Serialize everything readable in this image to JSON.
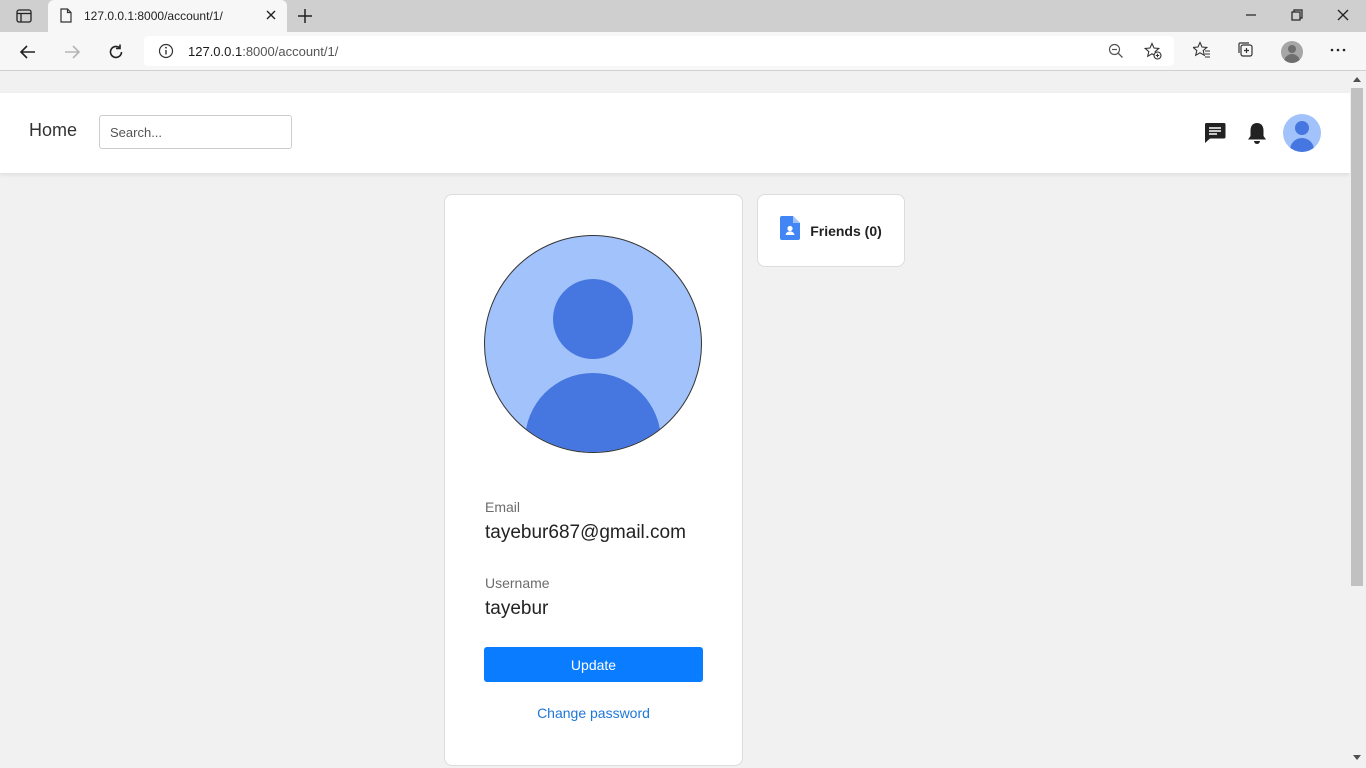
{
  "browser": {
    "tab_title": "127.0.0.1:8000/account/1/",
    "url_host": "127.0.0.1",
    "url_path": ":8000/account/1/"
  },
  "header": {
    "home_label": "Home",
    "search_placeholder": "Search..."
  },
  "profile": {
    "email_label": "Email",
    "email_value": "tayebur687@gmail.com",
    "username_label": "Username",
    "username_value": "tayebur",
    "update_label": "Update",
    "change_password_label": "Change password"
  },
  "friends": {
    "label": "Friends (0)"
  },
  "colors": {
    "accent": "#0a7cff",
    "link": "#1e77d8",
    "avatar_bg": "#a1c2fa",
    "avatar_fg": "#4677e0"
  }
}
